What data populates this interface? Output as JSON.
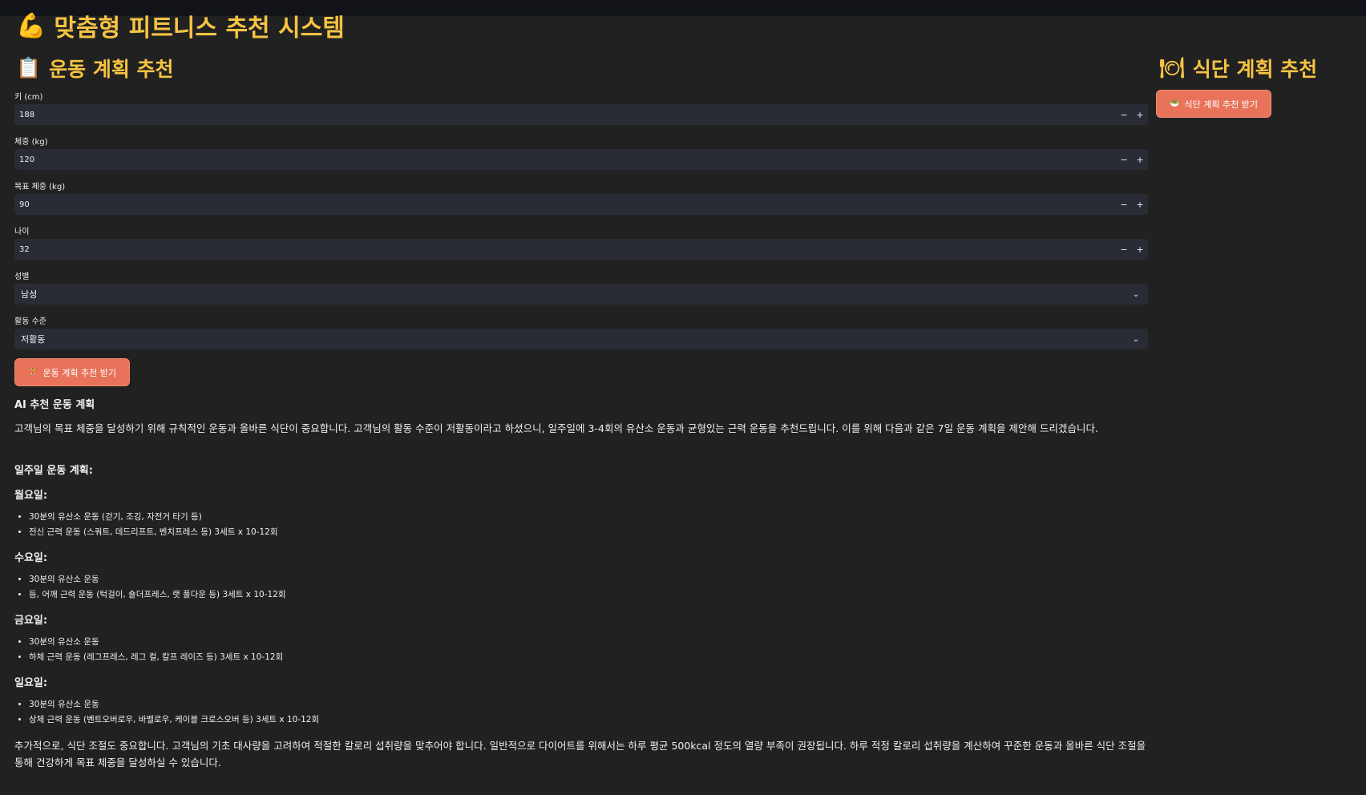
{
  "app": {
    "title": "맞춤형 피트니스 추천 시스템",
    "title_emoji": "💪"
  },
  "exercise": {
    "section_title": "운동 계획 추천",
    "section_emoji": "📋",
    "fields": {
      "height": {
        "label": "키 (cm)",
        "value": "188"
      },
      "weight": {
        "label": "체중 (kg)",
        "value": "120"
      },
      "target_weight": {
        "label": "목표 체중 (kg)",
        "value": "90"
      },
      "age": {
        "label": "나이",
        "value": "32"
      },
      "gender": {
        "label": "성별",
        "value": "남성"
      },
      "activity": {
        "label": "활동 수준",
        "value": "저활동"
      }
    },
    "stepper": {
      "minus": "−",
      "plus": "+"
    },
    "select_chevron": "⌄",
    "button_label": "운동 계획 추천 받기",
    "button_icon": "🏋"
  },
  "diet": {
    "section_title": "식단 계획 추천",
    "section_emoji": "🍽",
    "button_label": "식단 계획 추천 받기",
    "button_icon": "🥗"
  },
  "result": {
    "heading": "AI 추천 운동 계획",
    "intro": "고객님의 목표 체중을 달성하기 위해 규칙적인 운동과 올바른 식단이 중요합니다. 고객님의 활동 수준이 저활동이라고 하셨으니, 일주일에 3-4회의 유산소 운동과 균형있는 근력 운동을 추천드립니다. 이를 위해 다음과 같은 7일 운동 계획을 제안해 드리겠습니다.",
    "weekly_heading": "일주일 운동 계획:",
    "days": [
      {
        "name": "월요일:",
        "items": [
          "30분의 유산소 운동 (걷기, 조깅, 자전거 타기 등)",
          "전신 근력 운동 (스쿼트, 데드리프트, 벤치프레스 등) 3세트 x 10-12회"
        ]
      },
      {
        "name": "수요일:",
        "items": [
          "30분의 유산소 운동",
          "등, 어깨 근력 운동 (턱걸이, 숄더프레스, 랫 풀다운 등) 3세트 x 10-12회"
        ]
      },
      {
        "name": "금요일:",
        "items": [
          "30분의 유산소 운동",
          "하체 근력 운동 (레그프레스, 레그 컬, 칼프 레이즈 등) 3세트 x 10-12회"
        ]
      },
      {
        "name": "일요일:",
        "items": [
          "30분의 유산소 운동",
          "상체 근력 운동 (벤트오버로우, 바벨로우, 케이블 크로스오버 등) 3세트 x 10-12회"
        ]
      }
    ],
    "outro": "추가적으로, 식단 조절도 중요합니다. 고객님의 기초 대사량을 고려하여 적절한 칼로리 섭취량을 맞추어야 합니다. 일반적으로 다이어트를 위해서는 하루 평균 500kcal 정도의 열량 부족이 권장됩니다. 하루 적정 칼로리 섭취량을 계산하여 꾸준한 운동과 올바른 식단 조절을 통해 건강하게 목표 체중을 달성하실 수 있습니다."
  }
}
